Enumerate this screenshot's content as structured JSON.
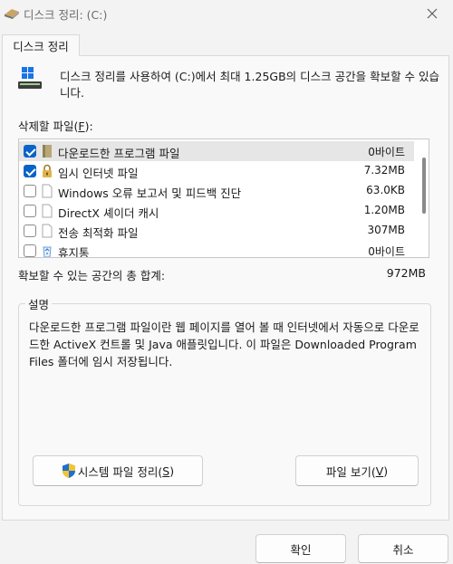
{
  "window": {
    "title": "디스크 정리: (C:)"
  },
  "tab": {
    "label": "디스크 정리"
  },
  "intro": {
    "text": "디스크 정리를 사용하여 (C:)에서 최대 1.25GB의 디스크 공간을 확보할 수 있습니다."
  },
  "files": {
    "label": "삭제할 파일",
    "accel_prefix": "(",
    "accel": "F",
    "accel_suffix": "):",
    "items": [
      {
        "name": "다운로드한 프로그램 파일",
        "size": "0바이트",
        "checked": true,
        "icon": "folder-icon"
      },
      {
        "name": "임시 인터넷 파일",
        "size": "7.32MB",
        "checked": true,
        "icon": "lock-icon"
      },
      {
        "name": "Windows 오류 보고서 및 피드백 진단",
        "size": "63.0KB",
        "checked": false,
        "icon": "file-icon"
      },
      {
        "name": "DirectX 셰이더 캐시",
        "size": "1.20MB",
        "checked": false,
        "icon": "file-icon"
      },
      {
        "name": "전송 최적화 파일",
        "size": "307MB",
        "checked": false,
        "icon": "file-icon"
      },
      {
        "name": "휴지통",
        "size": "0바이트",
        "checked": false,
        "icon": "recycle-bin-icon"
      }
    ]
  },
  "total": {
    "label": "확보할 수 있는 공간의 총 합계:",
    "value": "972MB"
  },
  "description": {
    "title": "설명",
    "text": "다운로드한 프로그램 파일이란 웹 페이지를 열어 볼 때 인터넷에서 자동으로 다운로드한 ActiveX 컨트롤 및 Java 애플릿입니다. 이 파일은 Downloaded Program Files 폴더에 임시 저장됩니다."
  },
  "buttons": {
    "system_cleanup": {
      "label": "시스템 파일 정리(",
      "accel": "S",
      "suffix": ")"
    },
    "view_files": {
      "label": "파일 보기(",
      "accel": "V",
      "suffix": ")"
    },
    "ok": "확인",
    "cancel": "취소"
  },
  "colors": {
    "accent": "#0a64c8",
    "selected_row": "#e6e6e6"
  }
}
